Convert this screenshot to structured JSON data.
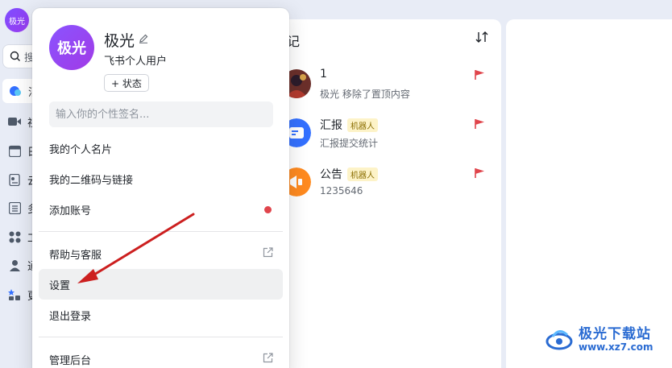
{
  "rail": {
    "avatar_text": "极光",
    "search_label": "搜",
    "items": [
      {
        "label": "消",
        "icon": "message-icon"
      },
      {
        "label": "视",
        "icon": "video-icon"
      },
      {
        "label": "日",
        "icon": "calendar-icon"
      },
      {
        "label": "云",
        "icon": "docs-icon"
      },
      {
        "label": "多",
        "icon": "list-icon"
      },
      {
        "label": "工",
        "icon": "apps-icon"
      },
      {
        "label": "通",
        "icon": "contacts-icon"
      },
      {
        "label": "更",
        "icon": "more-apps-icon"
      }
    ]
  },
  "chat_list": {
    "title": "记",
    "items": [
      {
        "name": "1",
        "tag": "",
        "subtitle": "极光 移除了置顶内容"
      },
      {
        "name": "汇报",
        "tag": "机器人",
        "subtitle": "汇报提交统计"
      },
      {
        "name": "公告",
        "tag": "机器人",
        "subtitle": "1235646"
      }
    ]
  },
  "profile": {
    "avatar_text": "极光",
    "name": "极光",
    "role": "飞书个人用户",
    "status_button": "+ 状态",
    "signature_placeholder": "输入你的个性签名..."
  },
  "menu": {
    "business_card": "我的个人名片",
    "qr_link": "我的二维码与链接",
    "add_account": "添加账号",
    "help": "帮助与客服",
    "settings": "设置",
    "logout": "退出登录",
    "admin": "管理后台"
  },
  "colors": {
    "accent": "#7c4dff",
    "flag": "#e0454c",
    "arrow": "#cc1f1f"
  },
  "watermark": {
    "title": "极光下载站",
    "url": "www.xz7.com"
  }
}
